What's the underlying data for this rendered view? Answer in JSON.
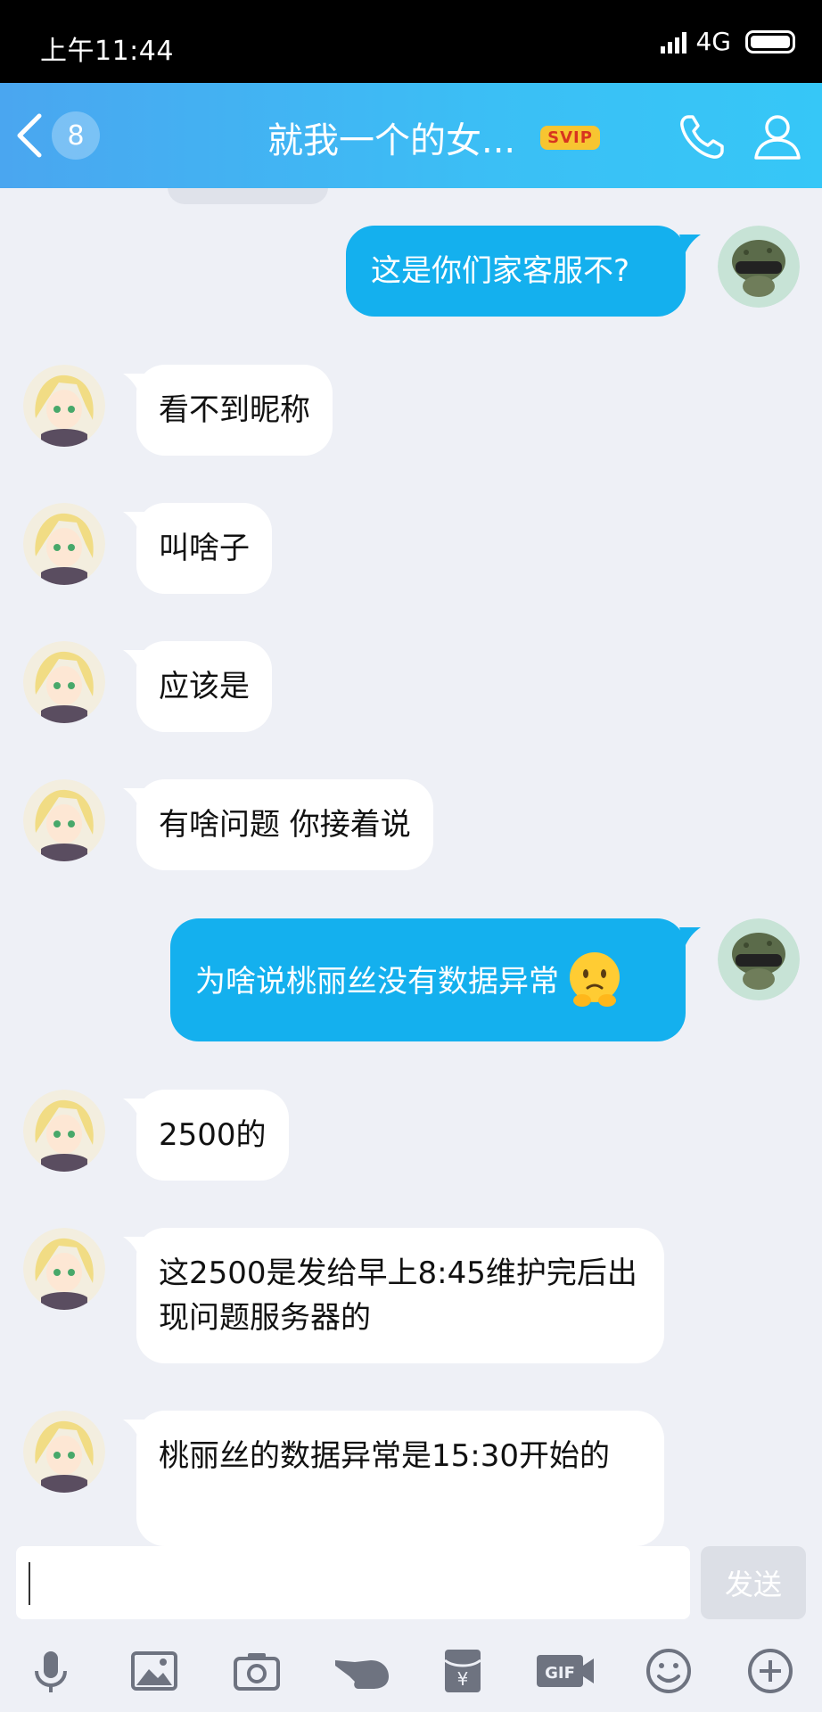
{
  "status_bar": {
    "time": "上午11:44",
    "network": "4G"
  },
  "header": {
    "unread_count": "8",
    "title": "就我一个的女...",
    "badge": "SVIP"
  },
  "messages": [
    {
      "side": "outgoing",
      "text": "这是你们家客服不?"
    },
    {
      "side": "incoming",
      "text": "看不到昵称"
    },
    {
      "side": "incoming",
      "text": "叫啥子"
    },
    {
      "side": "incoming",
      "text": "应该是"
    },
    {
      "side": "incoming",
      "text": "有啥问题 你接着说"
    },
    {
      "side": "outgoing",
      "text": "为啥说桃丽丝没有数据异常",
      "emoji": "worried-face"
    },
    {
      "side": "incoming",
      "text": "2500的"
    },
    {
      "side": "incoming",
      "text": "这2500是发给早上8:45维护完后出现问题服务器的"
    },
    {
      "side": "incoming",
      "text": "桃丽丝的数据异常是15:30开始的"
    }
  ],
  "input": {
    "value": "",
    "send_label": "发送"
  },
  "toolbar": {
    "items": [
      "microphone-icon",
      "image-icon",
      "camera-icon",
      "poke-hand-icon",
      "red-packet-icon",
      "gif-icon",
      "emoji-icon",
      "plus-icon"
    ]
  },
  "colors": {
    "header_start": "#4aa6f0",
    "header_end": "#36c7f7",
    "outgoing_bubble": "#14b0ee",
    "incoming_bubble": "#ffffff",
    "background": "#eef0f6"
  }
}
